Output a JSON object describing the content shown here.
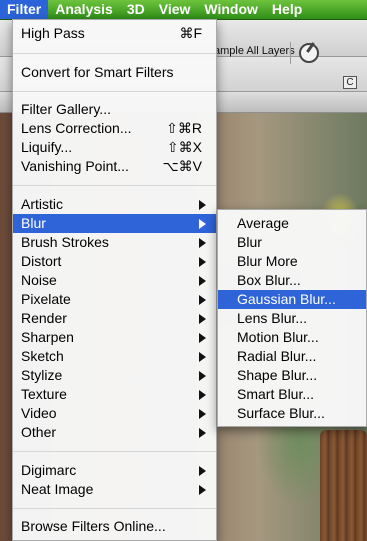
{
  "menubar": {
    "items": [
      "Filter",
      "Analysis",
      "3D",
      "View",
      "Window",
      "Help"
    ],
    "active": "Filter"
  },
  "toolbar": {
    "sample_layers_label": "ample All Layers",
    "tool_icon": "target-icon"
  },
  "tabstrip": {
    "tab_icon_text": "C"
  },
  "filter_menu": {
    "high_pass": {
      "label": "High Pass",
      "shortcut": "⌘F"
    },
    "convert_smart": {
      "label": "Convert for Smart Filters"
    },
    "filter_gallery": {
      "label": "Filter Gallery..."
    },
    "lens_correction": {
      "label": "Lens Correction...",
      "shortcut": "⇧⌘R"
    },
    "liquify": {
      "label": "Liquify...",
      "shortcut": "⇧⌘X"
    },
    "vanishing_point": {
      "label": "Vanishing Point...",
      "shortcut": "⌥⌘V"
    },
    "categories": [
      {
        "label": "Artistic"
      },
      {
        "label": "Blur"
      },
      {
        "label": "Brush Strokes"
      },
      {
        "label": "Distort"
      },
      {
        "label": "Noise"
      },
      {
        "label": "Pixelate"
      },
      {
        "label": "Render"
      },
      {
        "label": "Sharpen"
      },
      {
        "label": "Sketch"
      },
      {
        "label": "Stylize"
      },
      {
        "label": "Texture"
      },
      {
        "label": "Video"
      },
      {
        "label": "Other"
      }
    ],
    "plugins": [
      {
        "label": "Digimarc"
      },
      {
        "label": "Neat Image"
      }
    ],
    "browse_online": {
      "label": "Browse Filters Online..."
    },
    "highlighted": "Blur"
  },
  "blur_submenu": {
    "items": [
      {
        "label": "Average"
      },
      {
        "label": "Blur"
      },
      {
        "label": "Blur More"
      },
      {
        "label": "Box Blur..."
      },
      {
        "label": "Gaussian Blur..."
      },
      {
        "label": "Lens Blur..."
      },
      {
        "label": "Motion Blur..."
      },
      {
        "label": "Radial Blur..."
      },
      {
        "label": "Shape Blur..."
      },
      {
        "label": "Smart Blur..."
      },
      {
        "label": "Surface Blur..."
      }
    ],
    "highlighted": "Gaussian Blur..."
  },
  "colors": {
    "menubar_green": "#2f8f18",
    "highlight_blue": "#2f63d8"
  }
}
